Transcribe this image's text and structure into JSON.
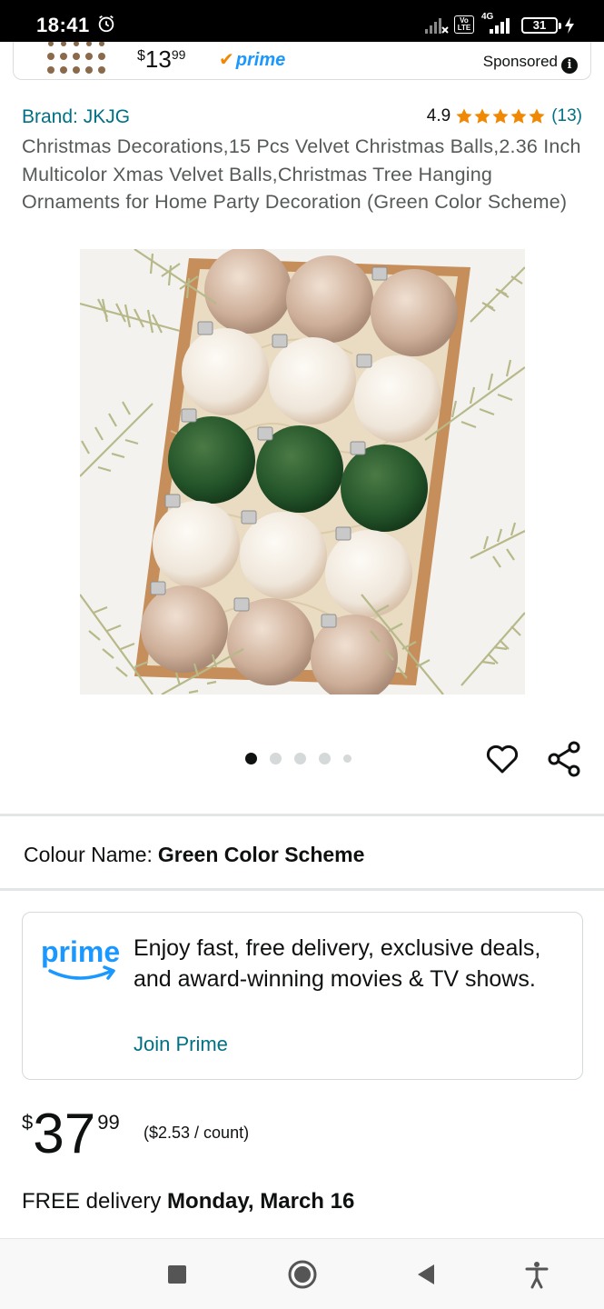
{
  "status_bar": {
    "time": "18:41",
    "volte_label": "Vo LTE",
    "network": "4G",
    "battery": "31",
    "icons": [
      "alarm-icon",
      "signal-icon",
      "volte-icon",
      "signal-icon",
      "battery-icon",
      "charging-icon"
    ]
  },
  "ad": {
    "currency": "$",
    "price_whole": "13",
    "price_frac": "99",
    "prime_label": "prime",
    "sponsored_label": "Sponsored"
  },
  "product": {
    "brand": "Brand: JKJG",
    "rating_value": "4.9",
    "stars": 5,
    "rating_count": "(13)",
    "title": "Christmas Decorations,15 Pcs Velvet Christmas Balls,2.36 Inch Multicolor Xmas Velvet Balls,Christmas Tree Hanging Ornaments for Home Party Decoration (Green Color Scheme)",
    "image_count": 5,
    "active_image": 0
  },
  "colour": {
    "label": "Colour Name:",
    "value": "Green Color Scheme"
  },
  "prime_card": {
    "logo_text": "prime",
    "message": "Enjoy fast, free delivery, exclusive deals, and award-winning movies & TV shows.",
    "link": "Join Prime"
  },
  "price": {
    "currency": "$",
    "whole": "37",
    "fraction": "99",
    "unit_price": "($2.53 / count)"
  },
  "delivery": {
    "prefix": "FREE delivery",
    "date": "Monday, March 16"
  },
  "colors": {
    "link": "#007185",
    "prime_blue": "#1a98ff",
    "star": "#f08804",
    "text": "#0f1111",
    "subtle_text": "#565959"
  },
  "nav": {
    "buttons": [
      "recents-icon",
      "home-icon",
      "back-icon",
      "accessibility-icon"
    ]
  }
}
